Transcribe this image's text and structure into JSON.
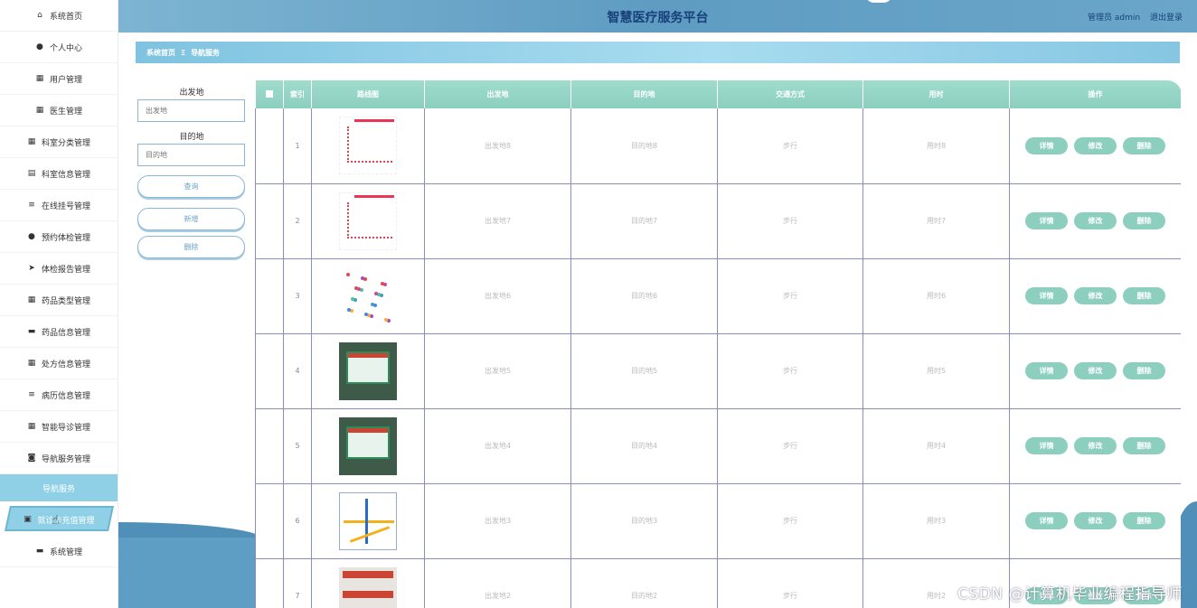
{
  "sidebar": {
    "items": [
      {
        "label": "系统首页",
        "icon": "home-icon"
      },
      {
        "label": "个人中心",
        "icon": "user-icon"
      },
      {
        "label": "用户管理",
        "icon": "grid-icon"
      },
      {
        "label": "医生管理",
        "icon": "grid-icon"
      },
      {
        "label": "科室分类管理",
        "icon": "grid-icon"
      },
      {
        "label": "科室信息管理",
        "icon": "clipboard-icon"
      },
      {
        "label": "在线挂号管理",
        "icon": "list-icon"
      },
      {
        "label": "预约体检管理",
        "icon": "user-icon"
      },
      {
        "label": "体检报告管理",
        "icon": "send-icon"
      },
      {
        "label": "药品类型管理",
        "icon": "grid-icon"
      },
      {
        "label": "药品信息管理",
        "icon": "monitor-icon"
      },
      {
        "label": "处方信息管理",
        "icon": "grid-icon"
      },
      {
        "label": "病历信息管理",
        "icon": "list-icon"
      },
      {
        "label": "智能导诊管理",
        "icon": "grid-icon"
      },
      {
        "label": "导航服务管理",
        "icon": "video-icon"
      }
    ],
    "sub_active": "导航服务",
    "sub_hover": {
      "label": "就诊卡充值管理",
      "icon": "briefcase-icon"
    },
    "last": {
      "label": "系统管理",
      "icon": "monitor-icon"
    }
  },
  "header": {
    "title": "智慧医疗服务平台",
    "user": "管理员 admin",
    "logout": "退出登录"
  },
  "breadcrumb": {
    "home": "系统首页",
    "sep": "Ξ",
    "current": "导航服务"
  },
  "search": {
    "from_label": "出发地",
    "from_placeholder": "出发地",
    "to_label": "目的地",
    "to_placeholder": "目的地",
    "query": "查询",
    "add": "新增",
    "delete": "删除"
  },
  "table": {
    "headers": [
      "索引",
      "路线图",
      "出发地",
      "目的地",
      "交通方式",
      "用时",
      "操作"
    ],
    "actions": {
      "detail": "详情",
      "edit": "修改",
      "delete": "删除"
    },
    "rows": [
      {
        "index": "1",
        "from": "出发地8",
        "to": "目的地8",
        "mode": "步行",
        "time": "用时8",
        "img": "map"
      },
      {
        "index": "2",
        "from": "出发地7",
        "to": "目的地7",
        "mode": "步行",
        "time": "用时7",
        "img": "map"
      },
      {
        "index": "3",
        "from": "出发地6",
        "to": "目的地6",
        "mode": "步行",
        "time": "用时6",
        "img": "city"
      },
      {
        "index": "4",
        "from": "出发地5",
        "to": "目的地5",
        "mode": "步行",
        "time": "用时5",
        "img": "photo"
      },
      {
        "index": "5",
        "from": "出发地4",
        "to": "目的地4",
        "mode": "步行",
        "time": "用时4",
        "img": "photo"
      },
      {
        "index": "6",
        "from": "出发地3",
        "to": "目的地3",
        "mode": "步行",
        "time": "用时3",
        "img": "subway"
      },
      {
        "index": "7",
        "from": "出发地2",
        "to": "目的地2",
        "mode": "步行",
        "time": "用时2",
        "img": "sign"
      }
    ]
  },
  "watermark": "CSDN @计算机毕业编程指导师"
}
